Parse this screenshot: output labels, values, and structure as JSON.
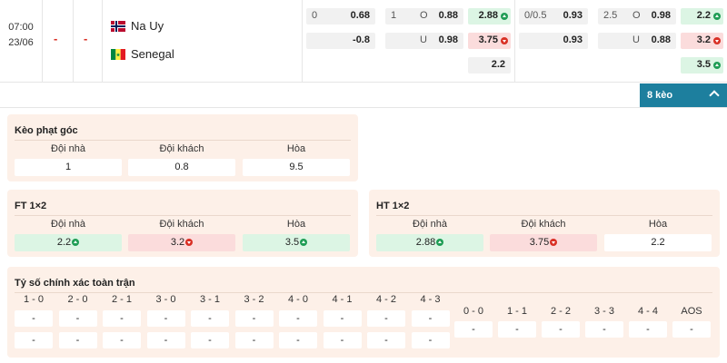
{
  "match": {
    "time": "07:00",
    "date": "23/06",
    "score_home": "-",
    "score_away": "-",
    "home_team": "Na Uy",
    "away_team": "Senegal"
  },
  "handicap_ft": {
    "home_line": "0",
    "home_odds": "0.68",
    "away_odds": "-0.8"
  },
  "ou_ft": {
    "line": "1",
    "over_label": "O",
    "over_odds": "0.88",
    "under_label": "U",
    "under_odds": "0.98"
  },
  "x12_ft": {
    "home": "2.88",
    "away": "3.75",
    "draw": "2.2"
  },
  "handicap_ht": {
    "home_line": "0/0.5",
    "home_odds": "0.93",
    "away_odds": "0.93"
  },
  "ou_ht": {
    "line": "2.5",
    "over_label": "O",
    "over_odds": "0.98",
    "under_label": "U",
    "under_odds": "0.88"
  },
  "x12_ht": {
    "home": "2.2",
    "away": "3.2",
    "draw": "3.5"
  },
  "more_button": {
    "label": "8 kèo"
  },
  "corners": {
    "title": "Kèo phạt góc",
    "headers": [
      "Đội nhà",
      "Đội khách",
      "Hòa"
    ],
    "values": [
      "1",
      "0.8",
      "9.5"
    ]
  },
  "ft1x2": {
    "title": "FT 1×2",
    "headers": [
      "Đội nhà",
      "Đội khách",
      "Hòa"
    ],
    "values": [
      "2.2",
      "3.2",
      "3.5"
    ]
  },
  "ht1x2": {
    "title": "HT 1×2",
    "headers": [
      "Đội nhà",
      "Đội khách",
      "Hòa"
    ],
    "values": [
      "2.88",
      "3.75",
      "2.2"
    ]
  },
  "correct_score": {
    "title": "Tỷ số chính xác toàn trận",
    "left_headers": [
      "1 - 0",
      "2 - 0",
      "2 - 1",
      "3 - 0",
      "3 - 1",
      "3 - 2",
      "4 - 0",
      "4 - 1",
      "4 - 2",
      "4 - 3"
    ],
    "right_headers": [
      "0 - 0",
      "1 - 1",
      "2 - 2",
      "3 - 3",
      "4 - 4",
      "AOS"
    ],
    "empty": "-"
  },
  "colors": {
    "accent": "#1d7f9e",
    "up": "#1f9d55",
    "down": "#d93025",
    "panel": "#fdf0e8"
  }
}
